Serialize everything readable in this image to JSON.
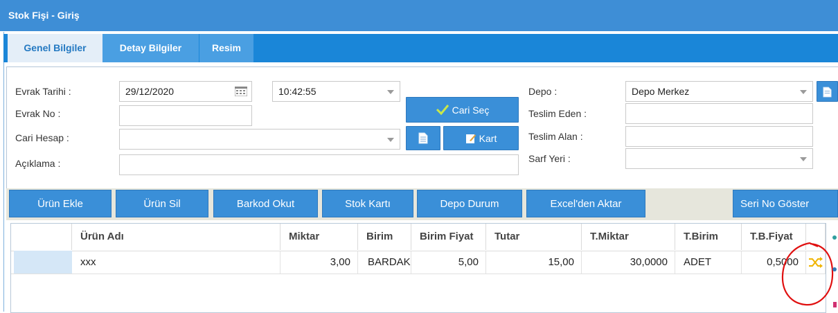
{
  "window": {
    "title": "Stok Fişi - Giriş"
  },
  "tabs": [
    {
      "label": "Genel Bilgiler",
      "active": true
    },
    {
      "label": "Detay Bilgiler",
      "active": false
    },
    {
      "label": "Resim",
      "active": false
    }
  ],
  "form": {
    "evrak_tarihi_label": "Evrak Tarihi :",
    "evrak_tarihi_value": "29/12/2020",
    "saat_value": "10:42:55",
    "evrak_no_label": "Evrak No :",
    "evrak_no_value": "",
    "cari_hesap_label": "Cari Hesap :",
    "cari_hesap_value": "",
    "aciklama_label": "Açıklama :",
    "aciklama_value": "",
    "cari_sec_label": "Cari Seç",
    "kart_label": "Kart",
    "depo_label": "Depo :",
    "depo_value": "Depo Merkez",
    "teslim_eden_label": "Teslim Eden :",
    "teslim_eden_value": "",
    "teslim_alan_label": "Teslim Alan :",
    "teslim_alan_value": "",
    "sarf_yeri_label": "Sarf Yeri :",
    "sarf_yeri_value": ""
  },
  "toolbar": {
    "urun_ekle": "Ürün Ekle",
    "urun_sil": "Ürün Sil",
    "barkod_okut": "Barkod Okut",
    "stok_karti": "Stok Kartı",
    "depo_durum": "Depo Durum",
    "excel_aktar": "Excel'den Aktar",
    "seri_no_goster": "Seri No Göster"
  },
  "grid": {
    "columns": [
      "Ürün Adı",
      "Miktar",
      "Birim",
      "Birim Fiyat",
      "Tutar",
      "T.Miktar",
      "T.Birim",
      "T.B.Fiyat"
    ],
    "rows": [
      {
        "urun_adi": "xxx",
        "miktar": "3,00",
        "birim": "BARDAK",
        "birim_fiyat": "5,00",
        "tutar": "15,00",
        "t_miktar": "30,0000",
        "t_birim": "ADET",
        "t_b_fiyat": "0,5000",
        "action_icon": "shuffle-icon"
      }
    ]
  },
  "colors": {
    "accent": "#1a86d8",
    "title_bar": "#3e8ed6",
    "button": "#3a8fd8",
    "annotation": "#e01010"
  }
}
